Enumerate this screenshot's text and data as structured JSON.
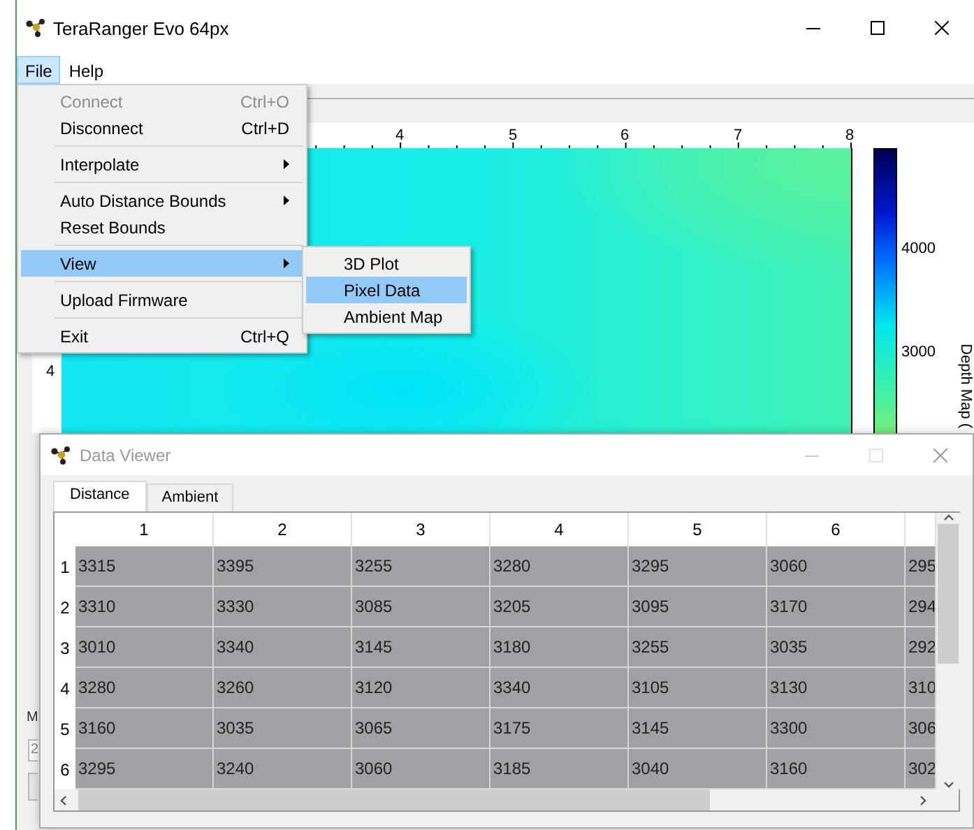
{
  "window": {
    "title": "TeraRanger Evo 64px"
  },
  "menubar": [
    {
      "label": "File",
      "selected": true
    },
    {
      "label": "Help",
      "selected": false
    }
  ],
  "plot": {
    "x_ticks": [
      "4",
      "5",
      "6",
      "7",
      "8"
    ],
    "y_ticks": [
      "4"
    ],
    "colorbar_ticks": [
      "4000",
      "3000"
    ],
    "colorbar_label": "Depth Map ("
  },
  "side_panel": {
    "label": "M",
    "field_value": "2"
  },
  "file_menu": [
    {
      "kind": "item",
      "label": "Connect",
      "shortcut": "Ctrl+O",
      "disabled": true,
      "submenu": false,
      "selected": false
    },
    {
      "kind": "item",
      "label": "Disconnect",
      "shortcut": "Ctrl+D",
      "disabled": false,
      "submenu": false,
      "selected": false
    },
    {
      "kind": "separator"
    },
    {
      "kind": "item",
      "label": "Interpolate",
      "disabled": false,
      "submenu": true,
      "selected": false
    },
    {
      "kind": "separator"
    },
    {
      "kind": "item",
      "label": "Auto Distance Bounds",
      "disabled": false,
      "submenu": true,
      "selected": false
    },
    {
      "kind": "item",
      "label": "Reset Bounds",
      "disabled": false,
      "submenu": false,
      "selected": false
    },
    {
      "kind": "separator"
    },
    {
      "kind": "item",
      "label": "View",
      "disabled": false,
      "submenu": true,
      "selected": true
    },
    {
      "kind": "separator"
    },
    {
      "kind": "item",
      "label": "Upload Firmware",
      "disabled": false,
      "submenu": false,
      "selected": false
    },
    {
      "kind": "separator"
    },
    {
      "kind": "item",
      "label": "Exit",
      "shortcut": "Ctrl+Q",
      "disabled": false,
      "submenu": false,
      "selected": false
    }
  ],
  "view_submenu": [
    {
      "label": "3D Plot",
      "selected": false
    },
    {
      "label": "Pixel Data",
      "selected": true
    },
    {
      "label": "Ambient Map",
      "selected": false
    }
  ],
  "data_viewer": {
    "title": "Data Viewer",
    "tabs": [
      {
        "label": "Distance",
        "selected": true
      },
      {
        "label": "Ambient",
        "selected": false
      }
    ],
    "table": {
      "columns": [
        "1",
        "2",
        "3",
        "4",
        "5",
        "6"
      ],
      "rows": [
        {
          "header": "1",
          "cells": [
            "3315",
            "3395",
            "3255",
            "3280",
            "3295",
            "3060",
            "295"
          ]
        },
        {
          "header": "2",
          "cells": [
            "3310",
            "3330",
            "3085",
            "3205",
            "3095",
            "3170",
            "294"
          ]
        },
        {
          "header": "3",
          "cells": [
            "3010",
            "3340",
            "3145",
            "3180",
            "3255",
            "3035",
            "292"
          ]
        },
        {
          "header": "4",
          "cells": [
            "3280",
            "3260",
            "3120",
            "3340",
            "3105",
            "3130",
            "310"
          ]
        },
        {
          "header": "5",
          "cells": [
            "3160",
            "3035",
            "3065",
            "3175",
            "3145",
            "3300",
            "306"
          ]
        },
        {
          "header": "6",
          "cells": [
            "3295",
            "3240",
            "3060",
            "3185",
            "3040",
            "3160",
            "302"
          ]
        }
      ]
    }
  }
}
